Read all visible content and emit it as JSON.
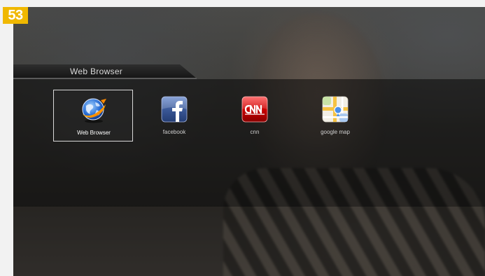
{
  "badge": {
    "number": "53"
  },
  "header": {
    "title": "Web Browser"
  },
  "apps": [
    {
      "label": "Web Browser",
      "icon": "web-browser-globe-icon",
      "selected": true
    },
    {
      "label": "facebook",
      "icon": "facebook-icon",
      "selected": false
    },
    {
      "label": "cnn",
      "icon": "cnn-icon",
      "selected": false
    },
    {
      "label": "google map",
      "icon": "google-map-icon",
      "selected": false
    }
  ],
  "colors": {
    "badge": "#f0b800",
    "facebook_blue": "#3b5998",
    "cnn_red": "#cc0000",
    "selection_border": "#d9d9d9"
  }
}
